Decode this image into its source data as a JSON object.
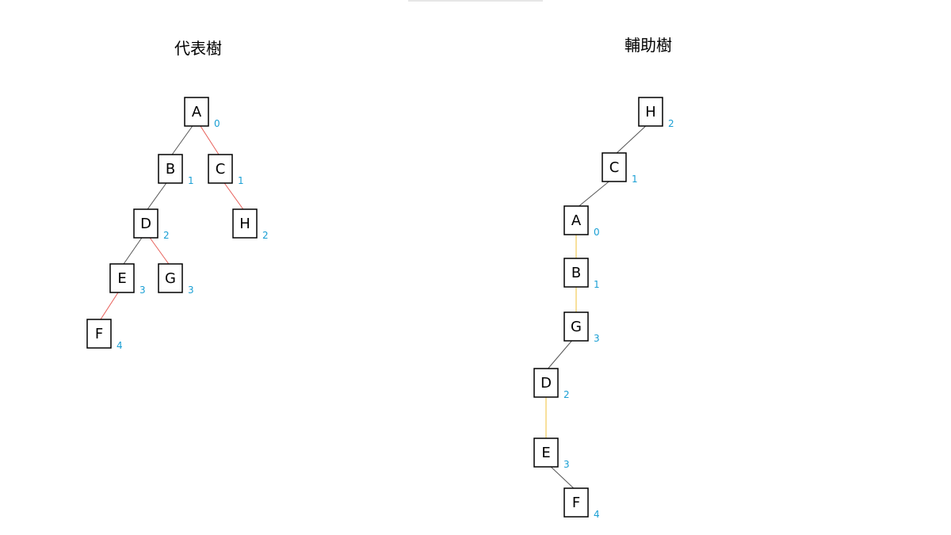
{
  "colors": {
    "depth": "#1a9fd4",
    "edge_black": "#555555",
    "edge_red": "#e8605a",
    "edge_yellow": "#f0c23a"
  },
  "left_tree": {
    "title": "代表樹",
    "nodes": [
      {
        "id": "A",
        "label": "A",
        "depth": "0"
      },
      {
        "id": "B",
        "label": "B",
        "depth": "1"
      },
      {
        "id": "C",
        "label": "C",
        "depth": "1"
      },
      {
        "id": "D",
        "label": "D",
        "depth": "2"
      },
      {
        "id": "H",
        "label": "H",
        "depth": "2"
      },
      {
        "id": "E",
        "label": "E",
        "depth": "3"
      },
      {
        "id": "G",
        "label": "G",
        "depth": "3"
      },
      {
        "id": "F",
        "label": "F",
        "depth": "4"
      }
    ],
    "edges": [
      {
        "from": "A",
        "to": "B",
        "type": "black"
      },
      {
        "from": "A",
        "to": "C",
        "type": "red"
      },
      {
        "from": "B",
        "to": "D",
        "type": "black"
      },
      {
        "from": "C",
        "to": "H",
        "type": "red"
      },
      {
        "from": "D",
        "to": "E",
        "type": "black"
      },
      {
        "from": "D",
        "to": "G",
        "type": "red"
      },
      {
        "from": "E",
        "to": "F",
        "type": "red"
      }
    ]
  },
  "right_tree": {
    "title": "輔助樹",
    "nodes": [
      {
        "id": "H",
        "label": "H",
        "depth": "2"
      },
      {
        "id": "C",
        "label": "C",
        "depth": "1"
      },
      {
        "id": "A",
        "label": "A",
        "depth": "0"
      },
      {
        "id": "B",
        "label": "B",
        "depth": "1"
      },
      {
        "id": "G",
        "label": "G",
        "depth": "3"
      },
      {
        "id": "D",
        "label": "D",
        "depth": "2"
      },
      {
        "id": "E",
        "label": "E",
        "depth": "3"
      },
      {
        "id": "F",
        "label": "F",
        "depth": "4"
      }
    ],
    "edges": [
      {
        "from": "H",
        "to": "C",
        "type": "black"
      },
      {
        "from": "C",
        "to": "A",
        "type": "black"
      },
      {
        "from": "A",
        "to": "B",
        "type": "yellow"
      },
      {
        "from": "B",
        "to": "G",
        "type": "yellow"
      },
      {
        "from": "G",
        "to": "D",
        "type": "black"
      },
      {
        "from": "D",
        "to": "E",
        "type": "yellow"
      },
      {
        "from": "E",
        "to": "F",
        "type": "black"
      }
    ]
  }
}
